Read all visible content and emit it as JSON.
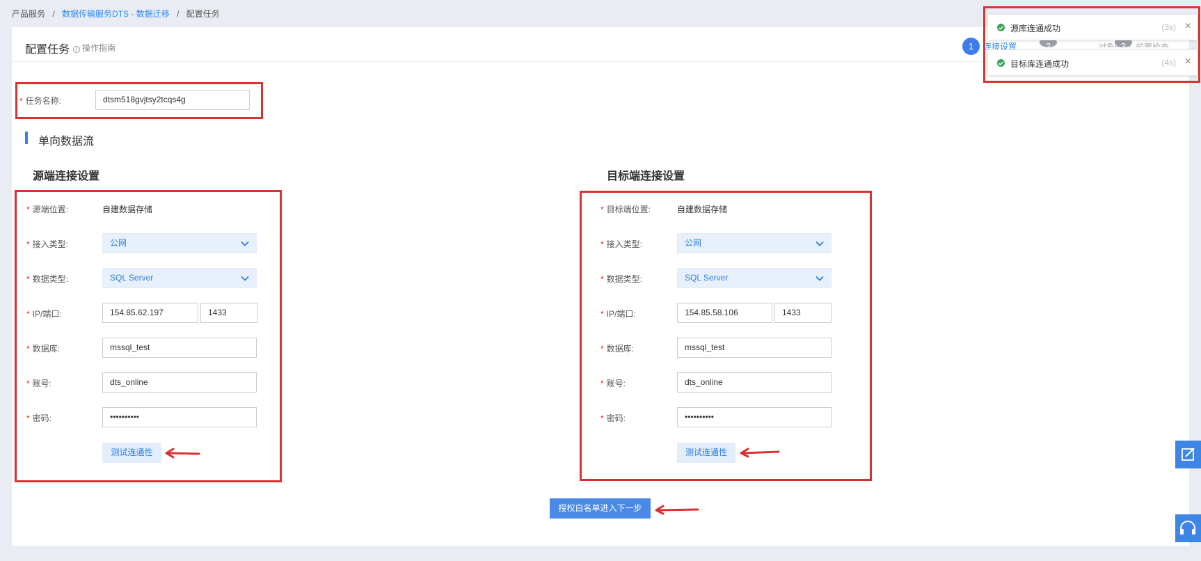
{
  "breadcrumb": {
    "items": [
      "产品服务",
      "数据传输服务DTS - 数据迁移",
      "配置任务"
    ],
    "separator": "/"
  },
  "header": {
    "title": "配置任务",
    "guide_link": "操作指南",
    "guide_icon": "info-icon"
  },
  "steps": {
    "step1_number": "1",
    "step1_label": "连接设置",
    "step2_number": "2",
    "step2_label": "对象映射",
    "step3_number": "3",
    "step3_label": "前置检查"
  },
  "task": {
    "name_label": "任务名称:",
    "name_value": "dtsm518gvjtsy2tcqs4g"
  },
  "section_title": "单向数据流",
  "source": {
    "title": "源端连接设置",
    "location_label": "源端位置:",
    "location_value": "自建数据存储",
    "access_label": "接入类型:",
    "access_value": "公网",
    "dbtype_label": "数据类型:",
    "dbtype_value": "SQL Server",
    "ip_label": "IP/端口:",
    "ip_value": "154.85.62.197",
    "port_value": "1433",
    "db_label": "数据库:",
    "db_value": "mssql_test",
    "account_label": "账号:",
    "account_value": "dts_online",
    "password_label": "密码:",
    "password_value": "••••••••••",
    "test_button": "测试连通性"
  },
  "target": {
    "title": "目标端连接设置",
    "location_label": "目标端位置:",
    "location_value": "自建数据存储",
    "access_label": "接入类型:",
    "access_value": "公网",
    "dbtype_label": "数据类型:",
    "dbtype_value": "SQL Server",
    "ip_label": "IP/端口:",
    "ip_value": "154.85.58.106",
    "port_value": "1433",
    "db_label": "数据库:",
    "db_value": "mssql_test",
    "account_label": "账号:",
    "account_value": "dts_online",
    "password_label": "密码:",
    "password_value": "••••••••••",
    "test_button": "测试连通性"
  },
  "required_mark": "*",
  "next_button": "授权白名单进入下一步",
  "toasts": [
    {
      "message": "源库连通成功",
      "timer": "(3s)",
      "close": "×"
    },
    {
      "message": "目标库连通成功",
      "timer": "(4s)",
      "close": "×"
    }
  ],
  "side_buttons": [
    "edit-icon",
    "headset-icon"
  ],
  "colors": {
    "accent": "#3e7de9",
    "highlight_red": "#d93232",
    "success_green": "#3aa655",
    "required_red": "#e0281f"
  }
}
